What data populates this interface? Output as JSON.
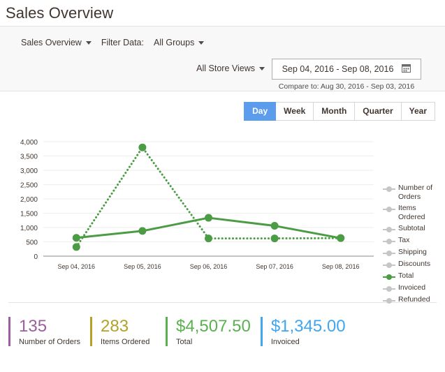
{
  "header": {
    "title": "Sales Overview"
  },
  "filters": {
    "report_select": {
      "label": "Sales Overview",
      "icon": "chevron-down-icon"
    },
    "filter_data_label": "Filter Data:",
    "group_select": {
      "label": "All Groups",
      "icon": "chevron-down-icon"
    },
    "store_view_select": {
      "label": "All Store Views",
      "icon": "chevron-down-icon"
    },
    "date_range": {
      "value": "Sep 04, 2016  -  Sep 08, 2016",
      "icon": "calendar-icon",
      "compare_to": "Compare to: Aug 30, 2016 - Sep 03, 2016"
    }
  },
  "period_tabs": {
    "active": "Day",
    "items": [
      {
        "label": "Day",
        "active": true
      },
      {
        "label": "Week",
        "active": false
      },
      {
        "label": "Month",
        "active": false
      },
      {
        "label": "Quarter",
        "active": false
      },
      {
        "label": "Year",
        "active": false
      }
    ]
  },
  "legend": {
    "items": [
      {
        "label": "Number of Orders",
        "active": false,
        "color": "#c6c6c6"
      },
      {
        "label": "Items Ordered",
        "active": false,
        "color": "#c6c6c6"
      },
      {
        "label": "Subtotal",
        "active": false,
        "color": "#c6c6c6"
      },
      {
        "label": "Tax",
        "active": false,
        "color": "#c6c6c6"
      },
      {
        "label": "Shipping",
        "active": false,
        "color": "#c6c6c6"
      },
      {
        "label": "Discounts",
        "active": false,
        "color": "#c6c6c6"
      },
      {
        "label": "Total",
        "active": true,
        "color": "#4c9c45"
      },
      {
        "label": "Invoiced",
        "active": false,
        "color": "#c6c6c6"
      },
      {
        "label": "Refunded",
        "active": false,
        "color": "#c6c6c6"
      }
    ]
  },
  "chart_data": {
    "type": "line",
    "title": "",
    "xlabel": "",
    "ylabel": "",
    "categories": [
      "Sep 04, 2016",
      "Sep 05, 2016",
      "Sep 06, 2016",
      "Sep 07, 2016",
      "Sep 08, 2016"
    ],
    "ytick_labels": [
      "4,000",
      "3,500",
      "3,000",
      "2,500",
      "2,000",
      "1,500",
      "1,000",
      "500",
      "0"
    ],
    "ytick_values": [
      4000,
      3500,
      3000,
      2500,
      2000,
      1500,
      1000,
      500,
      0
    ],
    "ylim": [
      0,
      4000
    ],
    "grid": true,
    "legend_position": "right",
    "series": [
      {
        "name": "Total",
        "style": "solid",
        "color": "#4c9c45",
        "values": [
          640,
          880,
          1340,
          1060,
          630
        ]
      },
      {
        "name": "Total (compare to: Aug 30, 2016 - Sep 03, 2016)",
        "style": "dotted",
        "color": "#4c9c45",
        "values": [
          320,
          3800,
          620,
          620,
          630
        ]
      }
    ]
  },
  "totals": {
    "items": [
      {
        "value": "135",
        "label": "Number of Orders",
        "color": "#9c5e9c"
      },
      {
        "value": "283",
        "label": "Items Ordered",
        "color": "#b3a12a"
      },
      {
        "value": "$4,507.50",
        "label": "Total",
        "color": "#5ab14f"
      },
      {
        "value": "$1,345.00",
        "label": "Invoiced",
        "color": "#41a6f0"
      }
    ]
  }
}
